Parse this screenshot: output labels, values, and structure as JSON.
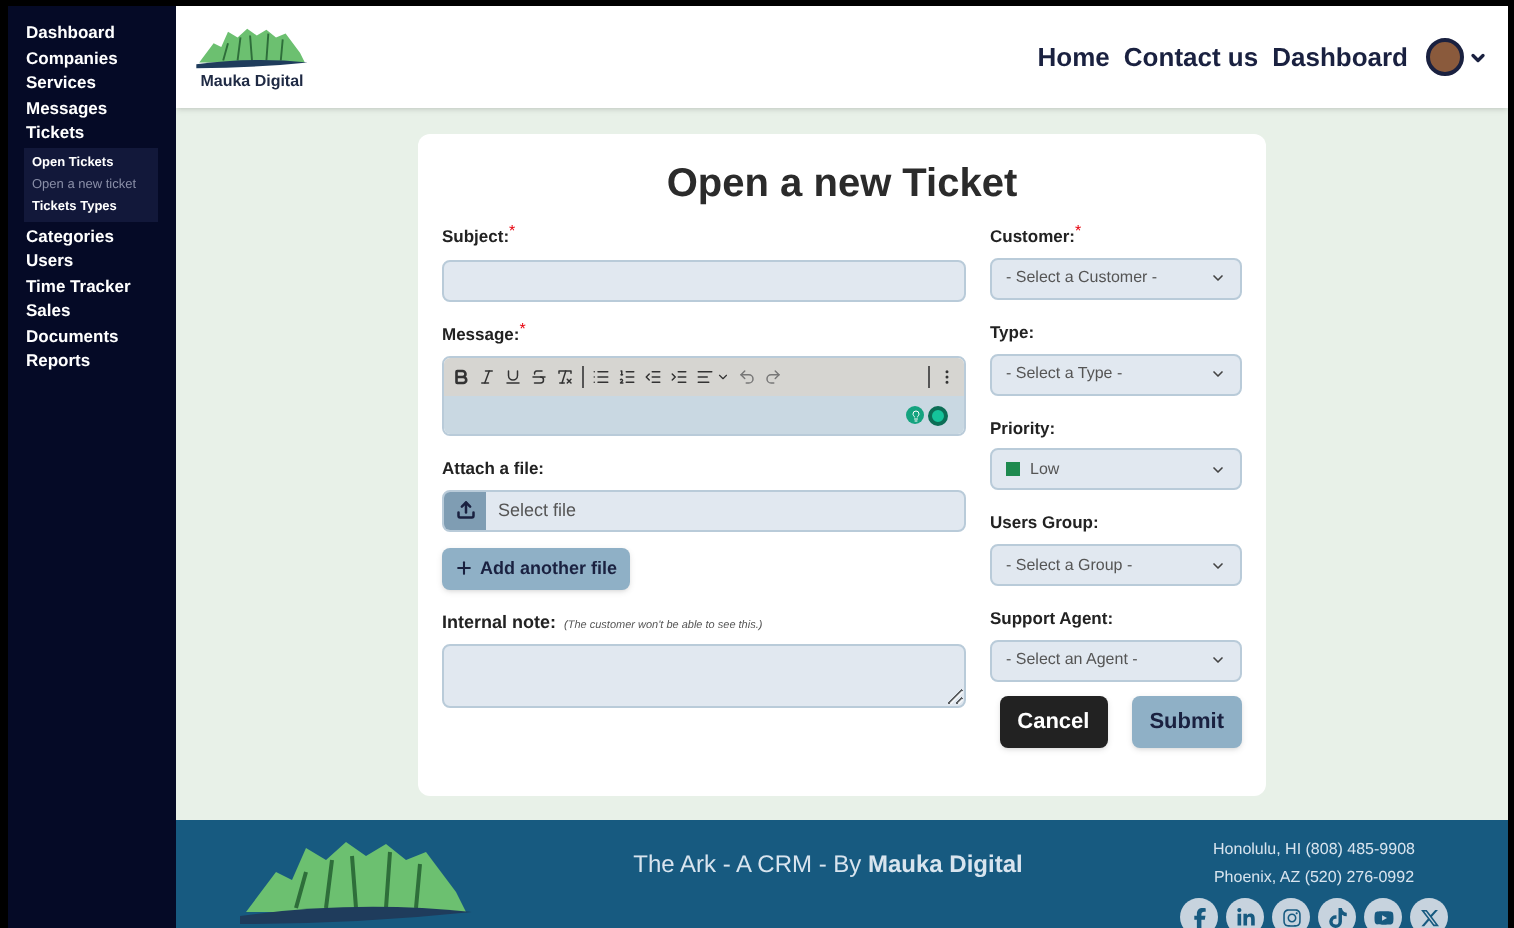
{
  "sidebar": {
    "items": [
      {
        "label": "Dashboard"
      },
      {
        "label": "Companies"
      },
      {
        "label": "Services"
      },
      {
        "label": "Messages"
      },
      {
        "label": "Tickets",
        "children": [
          {
            "label": "Open Tickets",
            "selected": false
          },
          {
            "label": "Open a new ticket",
            "selected": true
          },
          {
            "label": "Tickets Types",
            "selected": false
          }
        ]
      },
      {
        "label": "Categories"
      },
      {
        "label": "Users"
      },
      {
        "label": "Time Tracker"
      },
      {
        "label": "Sales"
      },
      {
        "label": "Documents"
      },
      {
        "label": "Reports"
      }
    ]
  },
  "header": {
    "logo_text": "Mauka Digital",
    "nav": [
      "Home",
      "Contact us",
      "Dashboard"
    ]
  },
  "form": {
    "title": "Open a new Ticket",
    "subject": {
      "label": "Subject:",
      "required_mark": "*"
    },
    "message": {
      "label": "Message:",
      "required_mark": "*"
    },
    "attach": {
      "label": "Attach a file:",
      "placeholder": "Select file"
    },
    "add_file_button": "Add another file",
    "internal_note": {
      "label": "Internal note:",
      "hint": "(The customer won't be able to see this.)"
    },
    "selects": [
      {
        "label": "Customer:",
        "required_mark": "*",
        "value": "- Select a Customer -"
      },
      {
        "label": "Type:",
        "value": "- Select a Type -"
      },
      {
        "label": "Priority:",
        "value": "Low",
        "color": "#1e8a4f"
      },
      {
        "label": "Users Group:",
        "value": "- Select a Group -"
      },
      {
        "label": "Support Agent:",
        "value": "- Select an Agent -"
      }
    ],
    "buttons": [
      {
        "label": "Cancel",
        "kind": "secondary"
      },
      {
        "label": "Submit",
        "kind": "primary"
      }
    ]
  },
  "footer": {
    "tagline": "The Ark - A CRM - By **Mauka Digital**",
    "addresses": [
      "Honolulu, HI (808) 485-9908",
      "Phoenix, AZ (520) 276-0992"
    ]
  }
}
